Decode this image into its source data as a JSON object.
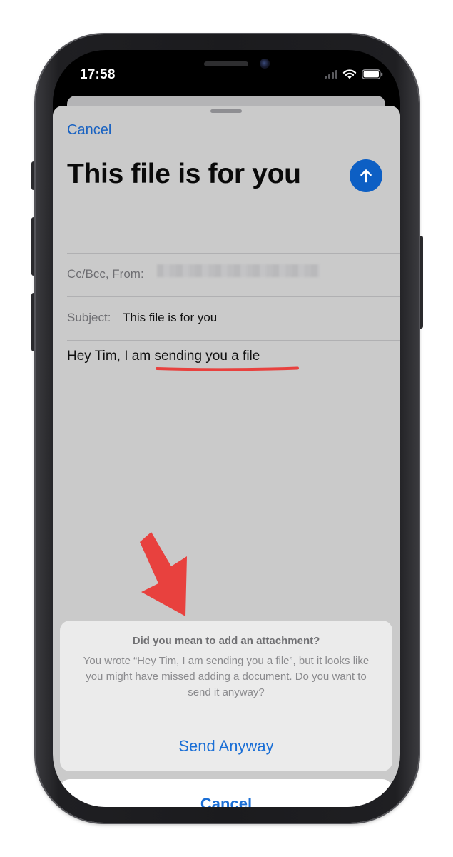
{
  "status_bar": {
    "time": "17:58"
  },
  "compose": {
    "cancel_label": "Cancel",
    "title": "This file is for you",
    "send_icon": "arrow-up-icon",
    "cc_bcc_label": "Cc/Bcc, From:",
    "subject_label": "Subject:",
    "subject_value": "This file is for you",
    "body_prefix": "Hey Tim, I am ",
    "body_highlight": "sending you a file"
  },
  "alert": {
    "title": "Did you mean to add an attachment?",
    "message": "You wrote “Hey Tim, I am sending you a file”, but it looks like you might have missed adding a document. Do you want to send it anyway?",
    "primary_action": "Send Anyway",
    "cancel_action": "Cancel"
  },
  "colors": {
    "accent_blue": "#1b6fd6",
    "annotation_red": "#e8413e",
    "sheet_background": "#cacaca"
  }
}
